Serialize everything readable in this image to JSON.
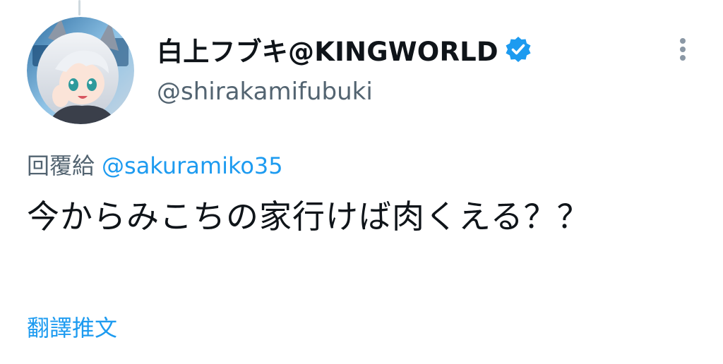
{
  "tweet": {
    "author": {
      "display_name": "白上フブキ@KINGWORLD",
      "handle": "@shirakamifubuki",
      "verified": true,
      "avatar_icon": "avatar-image"
    },
    "reply_prefix": "回覆給",
    "reply_to": "@sakuramiko35",
    "text": "今からみこちの家行けば肉くえる？？",
    "translate_label": "翻譯推文",
    "more_icon": "more-vertical-icon"
  },
  "colors": {
    "link": "#1d9bf0",
    "secondary_text": "#536471",
    "primary_text": "#0f1419",
    "verified_badge": "#1d9bf0",
    "thread_line": "#cfd9de"
  }
}
